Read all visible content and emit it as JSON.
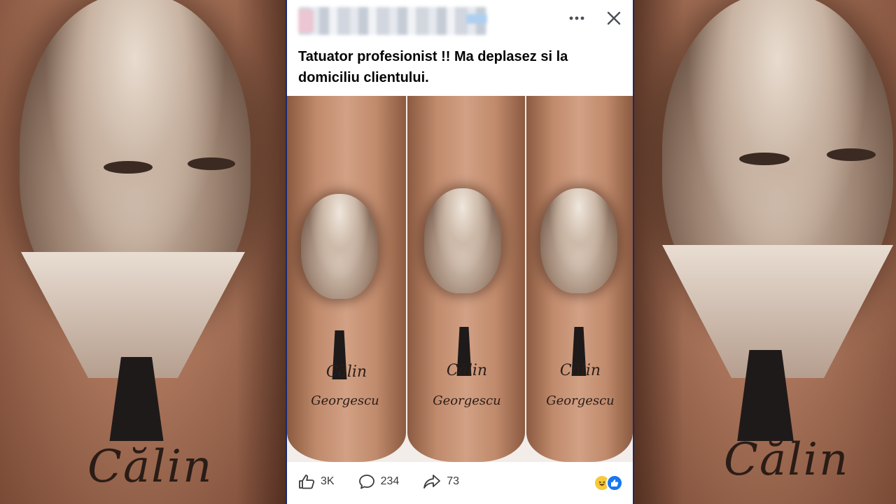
{
  "post": {
    "author_blurred": true,
    "more_icon": "more-horizontal-icon",
    "close_icon": "close-icon",
    "text_line1": "Tatuator profesionist !! Ma deplasez si la",
    "text_line2": "domiciliu clientului."
  },
  "photo": {
    "tattoo_text_line1": "Călin",
    "tattoo_text_line2": "Georgescu"
  },
  "background": {
    "tattoo_text": "Călin"
  },
  "footer": {
    "like_count": "3K",
    "comment_count": "234",
    "share_count": "73",
    "reactions": [
      "haha-reaction-icon",
      "like-reaction-icon"
    ]
  },
  "colors": {
    "brand_blue": "#1877f2",
    "frame_blue": "#1a2a6c",
    "text": "#050505"
  }
}
